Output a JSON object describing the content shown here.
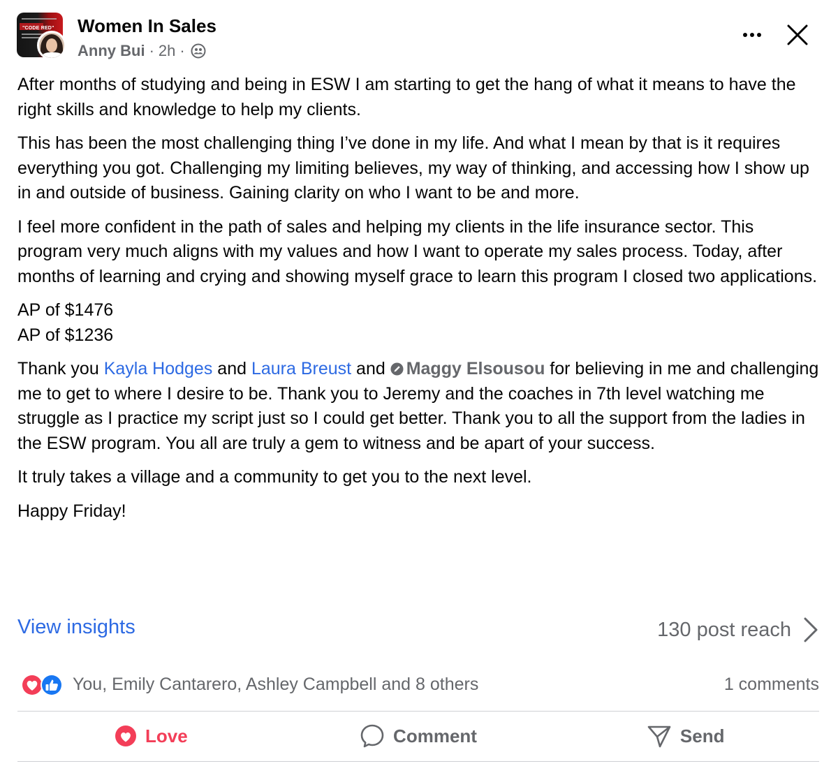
{
  "header": {
    "group_name": "Women In Sales",
    "author": "Anny Bui",
    "separator": "·",
    "time": "2h",
    "separator2": "·",
    "audience_icon": "group-audience-icon",
    "group_avatar_text": "\"CODE RED\""
  },
  "post": {
    "p1": "After months of studying and being in ESW I am starting to get the hang of what it means to have the right skills and knowledge to help my clients.",
    "p2": "This has been the most challenging thing I’ve done in my life. And what I mean by that is it requires everything you got. Challenging my limiting believes, my way of thinking, and accessing how I show up in and outside of business. Gaining clarity on who I want to be and more.",
    "p3": "I feel more confident in the path of sales and helping my clients in the life insurance sector. This program very much aligns with my values and how I want to operate my sales process. Today, after months of learning and crying and showing myself grace to learn this program I closed two applications.",
    "ap1": "AP of $1476",
    "ap2": "AP of $1236",
    "thanks_1": "Thank you ",
    "mention_1": "Kayla Hodges",
    "and_1": " and ",
    "mention_2": "Laura Breust",
    "and_2": " and ",
    "mention_3": "Maggy Elsousou",
    "thanks_2": " for believing in me and challenging me to get to where I desire to be. Thank you to Jeremy and the coaches in 7th level watching me struggle as I practice my script just so I could get better. Thank you to all the support from the ladies in the ESW program. You all are truly a gem to witness and be apart of your success.",
    "p5": "It truly takes a village and a community to get you to the next level.",
    "p6": "Happy Friday!"
  },
  "insights": {
    "link": "View insights",
    "reach": "130 post reach"
  },
  "reactions": {
    "icons": [
      "love-reaction-icon",
      "like-reaction-icon"
    ],
    "summary": "You, Emily Cantarero, Ashley Campbell and 8 others",
    "comments": "1 comments"
  },
  "actions": {
    "love": "Love",
    "comment": "Comment",
    "send": "Send"
  },
  "colors": {
    "link": "#2d6ae3",
    "secondary_text": "#65676b",
    "love": "#f33e58",
    "like": "#1877f2",
    "divider": "#ced0d4"
  }
}
